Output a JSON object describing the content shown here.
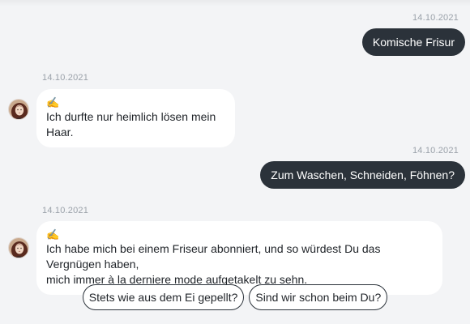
{
  "messages": [
    {
      "direction": "outgoing",
      "timestamp": "14.10.2021",
      "text": "Komische Frisur"
    },
    {
      "direction": "incoming",
      "timestamp": "14.10.2021",
      "emoji": "✍️",
      "text": "Ich durfte nur heimlich lösen mein Haar.",
      "avatar_icon": "portrait-avatar-icon"
    },
    {
      "direction": "outgoing",
      "timestamp": "14.10.2021",
      "text": "Zum Waschen, Schneiden, Föhnen?"
    },
    {
      "direction": "incoming",
      "timestamp": "14.10.2021",
      "emoji": "✍️",
      "text_line1": "Ich habe mich bei einem Friseur abonniert, und so würdest Du das Vergnügen haben,",
      "text_line2": "mich immer à la derniere mode aufgetakelt zu sehn.",
      "avatar_icon": "portrait-avatar-icon"
    }
  ],
  "quick_replies": [
    "Stets wie aus dem Ei gepellt?",
    "Sind wir schon beim Du?"
  ],
  "colors": {
    "background": "#f3f4f6",
    "outgoing_bubble": "#2b323a",
    "incoming_bubble": "#ffffff",
    "timestamp": "#9aa1a9"
  }
}
